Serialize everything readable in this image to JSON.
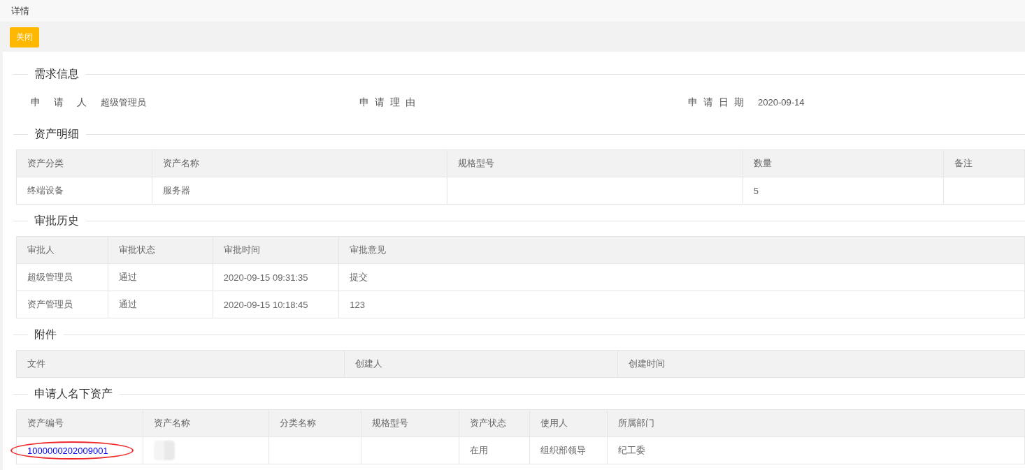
{
  "header": {
    "title": "详情"
  },
  "toolbar": {
    "buttons": [
      {
        "label": "关闭",
        "kind": "warning"
      }
    ]
  },
  "sections": [
    {
      "kind": "fields",
      "title": "需求信息",
      "fields": [
        {
          "label": "申请人",
          "value": "超级管理员"
        },
        {
          "label": "申请理由"
        },
        {
          "label": "申请日期",
          "value": "2020-09-14"
        }
      ]
    },
    {
      "kind": "table",
      "title": "资产明细",
      "columns": [
        "资产分类",
        "资产名称",
        "规格型号",
        "数量",
        "备注"
      ],
      "rows": [
        {
          "cells": [
            "终端设备",
            "服务器",
            "",
            "5",
            ""
          ]
        }
      ]
    },
    {
      "kind": "table",
      "title": "审批历史",
      "columns": [
        "审批人",
        "审批状态",
        "审批时间",
        "审批意见"
      ],
      "rows": [
        {
          "cells": [
            "超级管理员",
            "通过",
            "2020-09-15 09:31:35",
            "提交"
          ]
        },
        {
          "cells": [
            "资产管理员",
            "通过",
            "2020-09-15 10:18:45",
            "123"
          ]
        }
      ]
    },
    {
      "kind": "table",
      "title": "附件",
      "columns": [
        "文件",
        "创建人",
        "创建时间"
      ]
    },
    {
      "kind": "table",
      "title": "申请人名下资产",
      "columns": [
        "资产编号",
        "资产名称",
        "分类名称",
        "规格型号",
        "资产状态",
        "使用人",
        "所属部门"
      ],
      "rows": [
        {
          "cells": [
            {
              "kind": "link",
              "text": "1000000202009001"
            },
            {
              "kind": "blurred"
            },
            "",
            "",
            "在用",
            "组织部领导",
            "纪工委"
          ],
          "highlighted": true
        }
      ]
    }
  ]
}
